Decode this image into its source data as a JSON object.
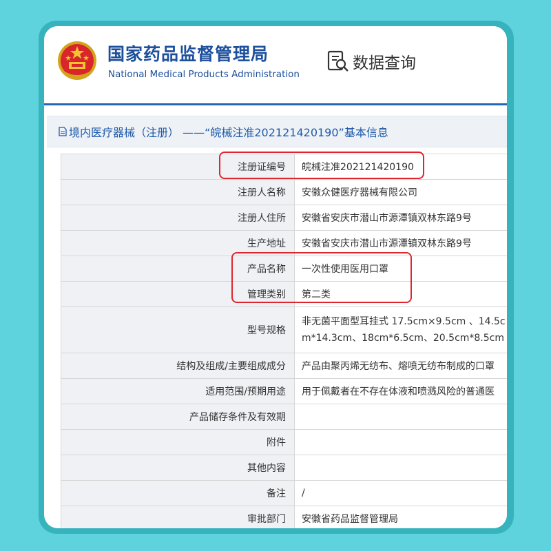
{
  "header": {
    "org_name_cn": "国家药品监督管理局",
    "org_name_en": "National Medical Products Administration",
    "query_label": "数据查询",
    "emblem_icon": "national-emblem-icon",
    "query_icon": "data-query-icon"
  },
  "breadcrumb": {
    "title": "境内医疗器械（注册） ——“皖械注准202121420190”基本信息",
    "icon": "document-icon"
  },
  "colors": {
    "accent": "#1f67b6",
    "highlight": "#e0262c",
    "background": "#5fd3dd"
  },
  "table": {
    "rows": [
      {
        "label": "注册证编号",
        "value": "皖械注准202121420190"
      },
      {
        "label": "注册人名称",
        "value": "安徽众健医疗器械有限公司"
      },
      {
        "label": "注册人住所",
        "value": "安徽省安庆市潜山市源潭镇双林东路9号"
      },
      {
        "label": "生产地址",
        "value": "安徽省安庆市潜山市源潭镇双林东路9号"
      },
      {
        "label": "产品名称",
        "value": "一次性使用医用口罩"
      },
      {
        "label": "管理类别",
        "value": "第二类"
      },
      {
        "label": "型号规格",
        "value": "非无菌平面型耳挂式 17.5cm×9.5cm 、14.5c",
        "value2": "m*14.3cm、18cm*6.5cm、20.5cm*8.5cm"
      },
      {
        "label": "结构及组成/主要组成成分",
        "value": "产品由聚丙烯无纺布、熔喷无纺布制成的口罩"
      },
      {
        "label": "适用范围/预期用途",
        "value": "用于佩戴者在不存在体液和喷溅风险的普通医"
      },
      {
        "label": "产品储存条件及有效期",
        "value": ""
      },
      {
        "label": "附件",
        "value": ""
      },
      {
        "label": "其他内容",
        "value": ""
      },
      {
        "label": "备注",
        "value": "/"
      },
      {
        "label": "审批部门",
        "value": "安徽省药品监督管理局"
      }
    ]
  }
}
